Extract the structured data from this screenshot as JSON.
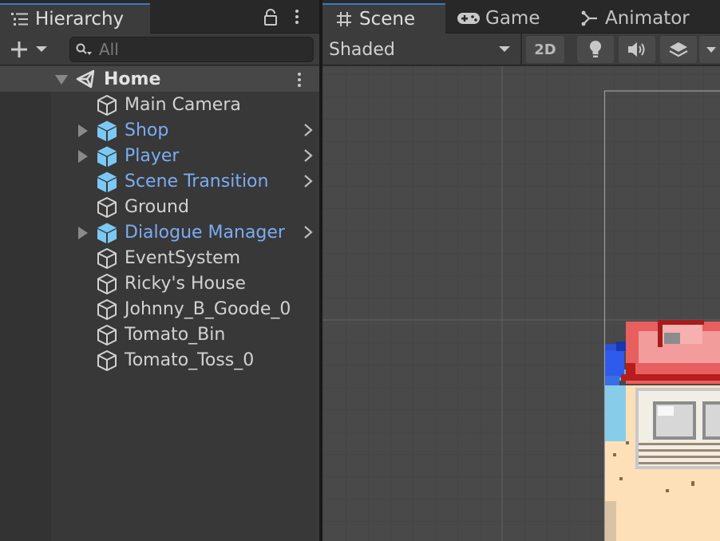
{
  "hierarchy": {
    "tab_label": "Hierarchy",
    "search_placeholder": "All",
    "scene_name": "Home",
    "items": [
      {
        "label": "Main Camera",
        "prefab": false,
        "expandable": false
      },
      {
        "label": "Shop",
        "prefab": true,
        "expandable": true
      },
      {
        "label": "Player",
        "prefab": true,
        "expandable": true
      },
      {
        "label": "Scene Transition",
        "prefab": true,
        "expandable": false
      },
      {
        "label": "Ground",
        "prefab": false,
        "expandable": false
      },
      {
        "label": "Dialogue Manager",
        "prefab": true,
        "expandable": true
      },
      {
        "label": "EventSystem",
        "prefab": false,
        "expandable": false
      },
      {
        "label": "Ricky's House",
        "prefab": false,
        "expandable": false
      },
      {
        "label": "Johnny_B_Goode_0",
        "prefab": false,
        "expandable": false
      },
      {
        "label": "Tomato_Bin",
        "prefab": false,
        "expandable": false
      },
      {
        "label": "Tomato_Toss_0",
        "prefab": false,
        "expandable": false
      }
    ]
  },
  "scene_view": {
    "tabs": [
      {
        "label": "Scene",
        "icon": "grid-icon",
        "active": true
      },
      {
        "label": "Game",
        "icon": "gamepad-icon",
        "active": false
      },
      {
        "label": "Animator",
        "icon": "animator-icon",
        "active": false
      }
    ],
    "shading_mode": "Shaded",
    "toggle_2d_label": "2D"
  },
  "colors": {
    "prefab_text": "#7bacf3",
    "prefab_icon": "#7cc8f4",
    "active_tab_accent": "#3a79bb"
  }
}
